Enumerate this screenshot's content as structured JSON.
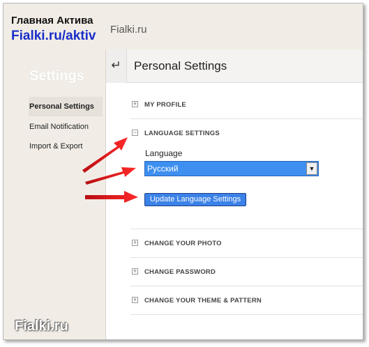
{
  "watermark": {
    "top_line": "Главная Актива",
    "url": "Fialki.ru/aktiv",
    "bottom": "Fialki.ru"
  },
  "site": {
    "name": "Fialki.ru"
  },
  "sidebar": {
    "title": "Settings",
    "items": [
      {
        "label": "Personal Settings",
        "active": true
      },
      {
        "label": "Email Notification",
        "active": false
      },
      {
        "label": "Import & Export",
        "active": false
      }
    ]
  },
  "panel": {
    "back_icon": "back-arrow-icon",
    "title": "Personal Settings",
    "sections": [
      {
        "label": "MY PROFILE",
        "toggle": "+"
      },
      {
        "label": "LANGUAGE SETTINGS",
        "toggle": "−"
      },
      {
        "label": "CHANGE YOUR PHOTO",
        "toggle": "+"
      },
      {
        "label": "CHANGE PASSWORD",
        "toggle": "+"
      },
      {
        "label": "CHANGE YOUR THEME & PATTERN",
        "toggle": "+"
      }
    ],
    "language": {
      "caption": "Language",
      "selected": "Русский",
      "update_button": "Update Language Settings"
    }
  },
  "annotation": {
    "arrow_color": "#e8141a"
  }
}
